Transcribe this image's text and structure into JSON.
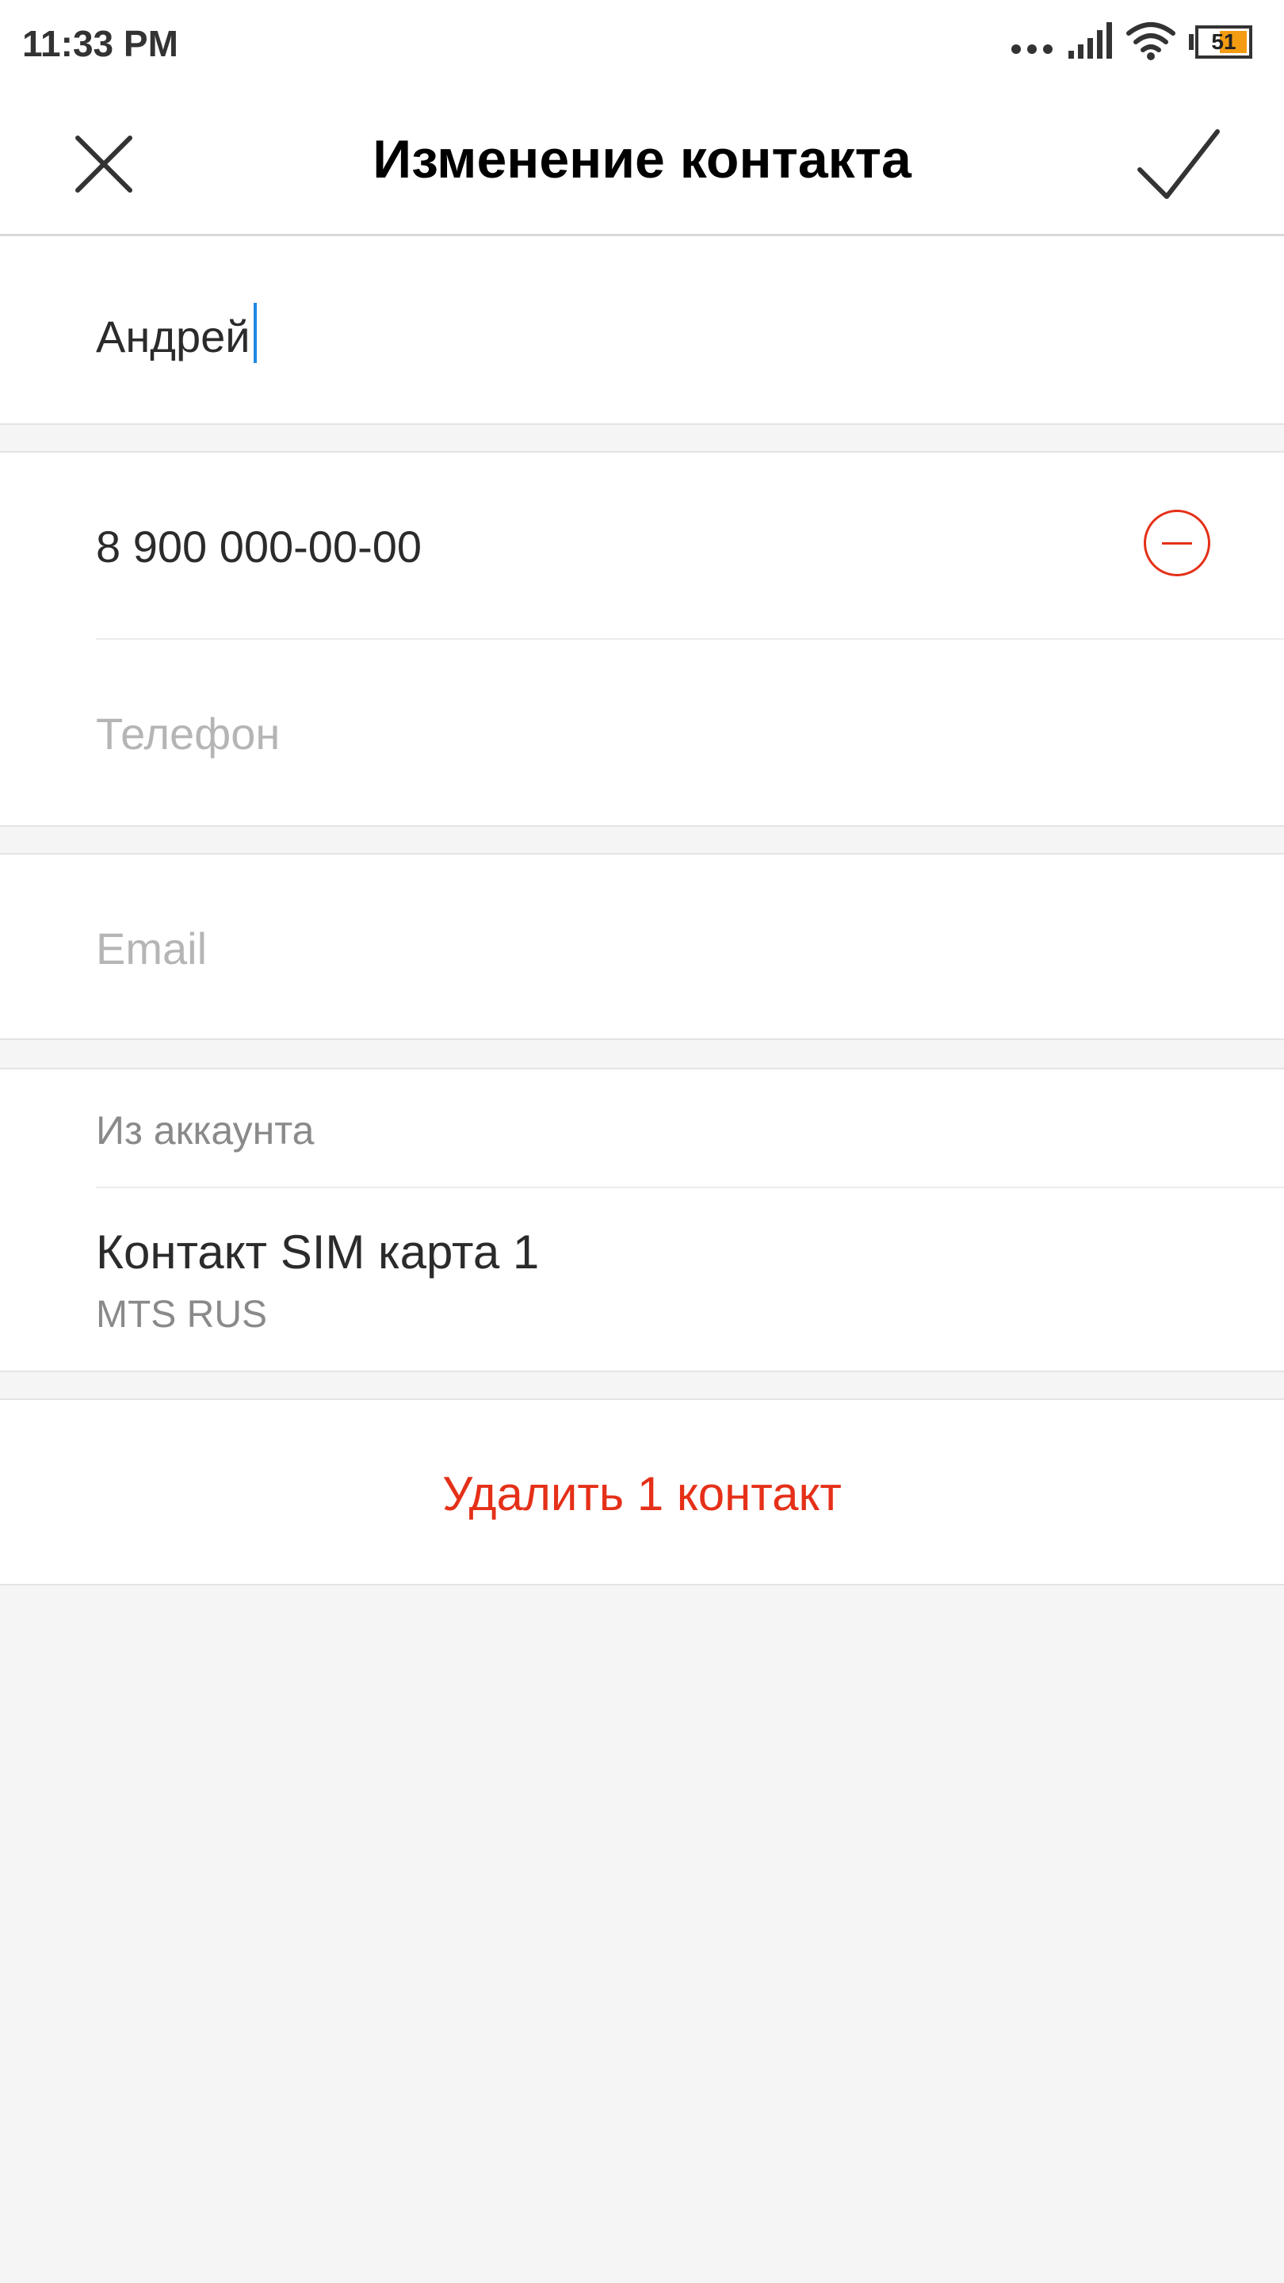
{
  "status_bar": {
    "time": "11:33 PM",
    "battery": "51",
    "icons": [
      "dots-icon",
      "signal-icon",
      "wifi-icon",
      "battery-icon"
    ]
  },
  "header": {
    "title": "Изменение контакта",
    "close_icon": "close-icon",
    "confirm_icon": "check-icon"
  },
  "name_field": {
    "value": "Андрей"
  },
  "phones": {
    "items": [
      {
        "value": "8 900 000-00-00"
      }
    ],
    "new_placeholder": "Телефон"
  },
  "email": {
    "placeholder": "Email"
  },
  "account": {
    "label": "Из аккаунта",
    "name": "Контакт SIM карта 1",
    "carrier": "MTS RUS"
  },
  "actions": {
    "delete_label": "Удалить 1 контакт"
  },
  "colors": {
    "accent_red": "#e53018",
    "cursor_blue": "#1e88e5",
    "background": "#f5f5f5"
  }
}
